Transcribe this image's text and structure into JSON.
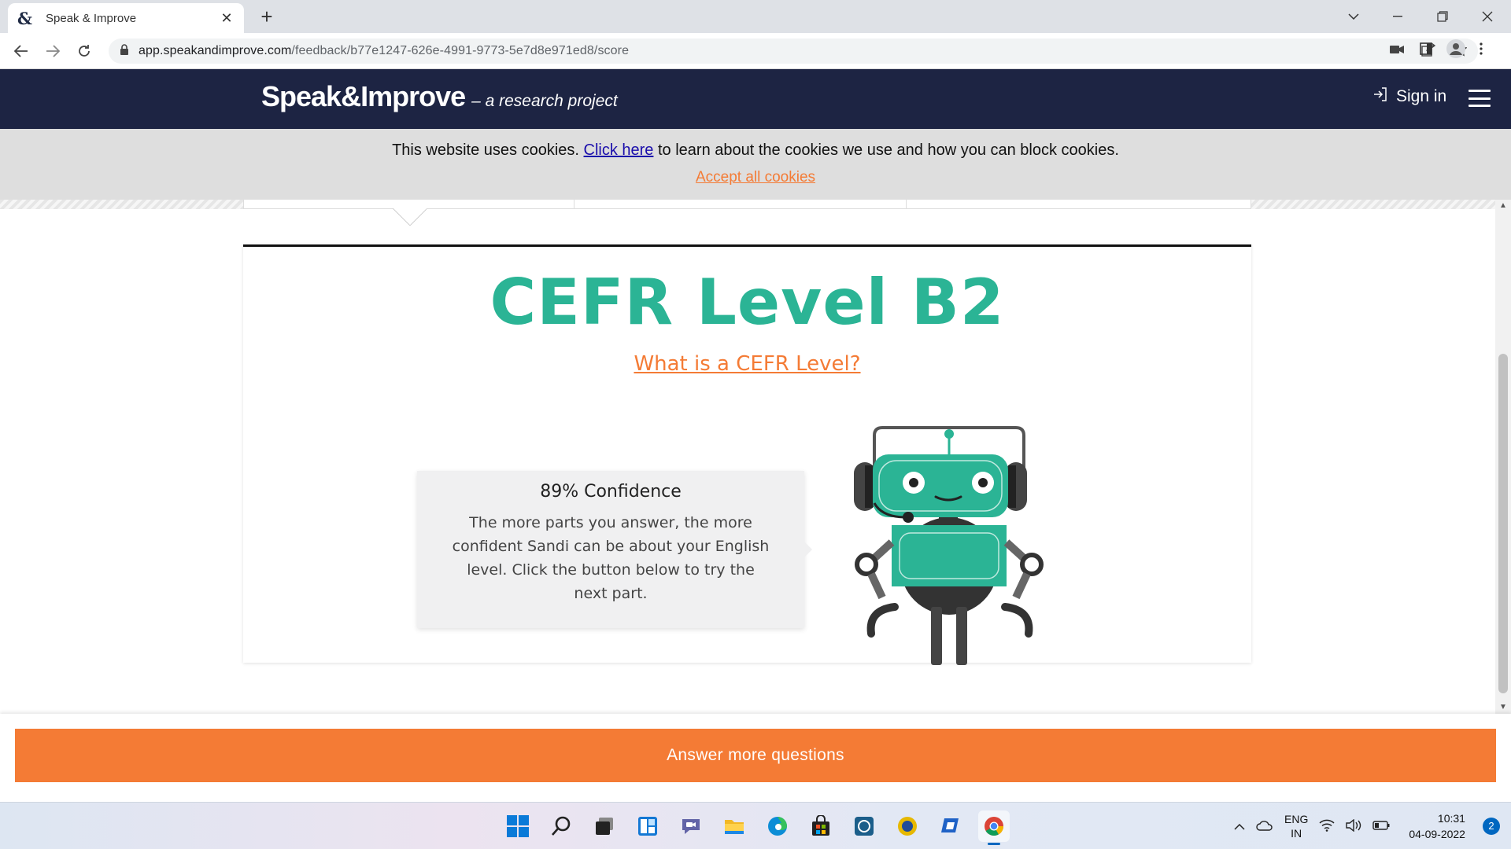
{
  "browser": {
    "tab_title": "Speak & Improve",
    "url_host": "app.speakandimprove.com",
    "url_path": "/feedback/b77e1247-626e-4991-9773-5e7d8e971ed8/score"
  },
  "header": {
    "brand": "Speak&Improve",
    "tagline": "– a research project",
    "signin": "Sign in"
  },
  "cookie": {
    "lead": "This website uses cookies.",
    "link": "Click here",
    "rest": " to learn about the cookies we use and how you can block cookies.",
    "accept": "Accept all cookies"
  },
  "result": {
    "level": "CEFR Level B2",
    "what_link": "What is a CEFR Level?",
    "confidence_title": "89% Confidence",
    "confidence_text": "The more parts you answer, the more confident Sandi can be about your English level. Click the button below to try the next part."
  },
  "action": {
    "answer_more": "Answer more questions"
  },
  "taskbar": {
    "lang_top": "ENG",
    "lang_bottom": "IN",
    "time": "10:31",
    "date": "04-09-2022",
    "notifications": "2"
  },
  "colors": {
    "header_bg": "#1d2443",
    "accent_teal": "#2bb495",
    "accent_orange": "#f47b35"
  }
}
